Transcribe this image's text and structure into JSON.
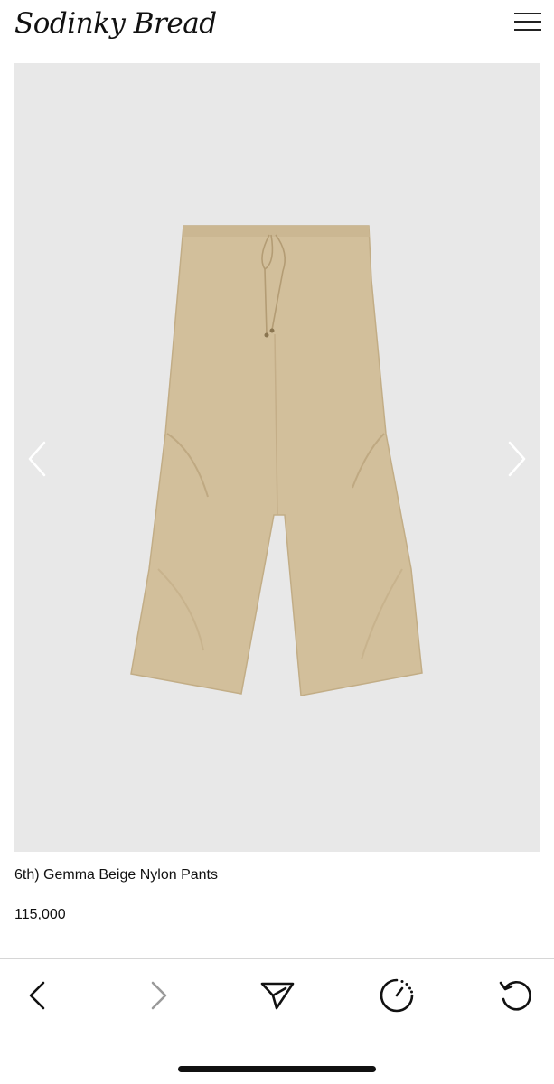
{
  "header": {
    "logo_text": "Sodinky Bread",
    "menu_icon": "hamburger-menu-icon"
  },
  "gallery": {
    "image_alt": "Gemma Beige Nylon Pants",
    "prev_icon": "chevron-left-icon",
    "next_icon": "chevron-right-icon",
    "background_color": "#e8e8e8",
    "product_color": "#d2bf9b"
  },
  "product": {
    "title": "6th) Gemma Beige Nylon Pants",
    "price": "115,000"
  },
  "toolbar": {
    "items": [
      {
        "name": "back",
        "icon": "chevron-left-icon",
        "enabled": true
      },
      {
        "name": "forward",
        "icon": "chevron-right-icon",
        "enabled": false
      },
      {
        "name": "share",
        "icon": "paper-plane-icon",
        "enabled": true
      },
      {
        "name": "timer",
        "icon": "timer-icon",
        "enabled": true
      },
      {
        "name": "reload",
        "icon": "reload-icon",
        "enabled": true
      }
    ]
  }
}
